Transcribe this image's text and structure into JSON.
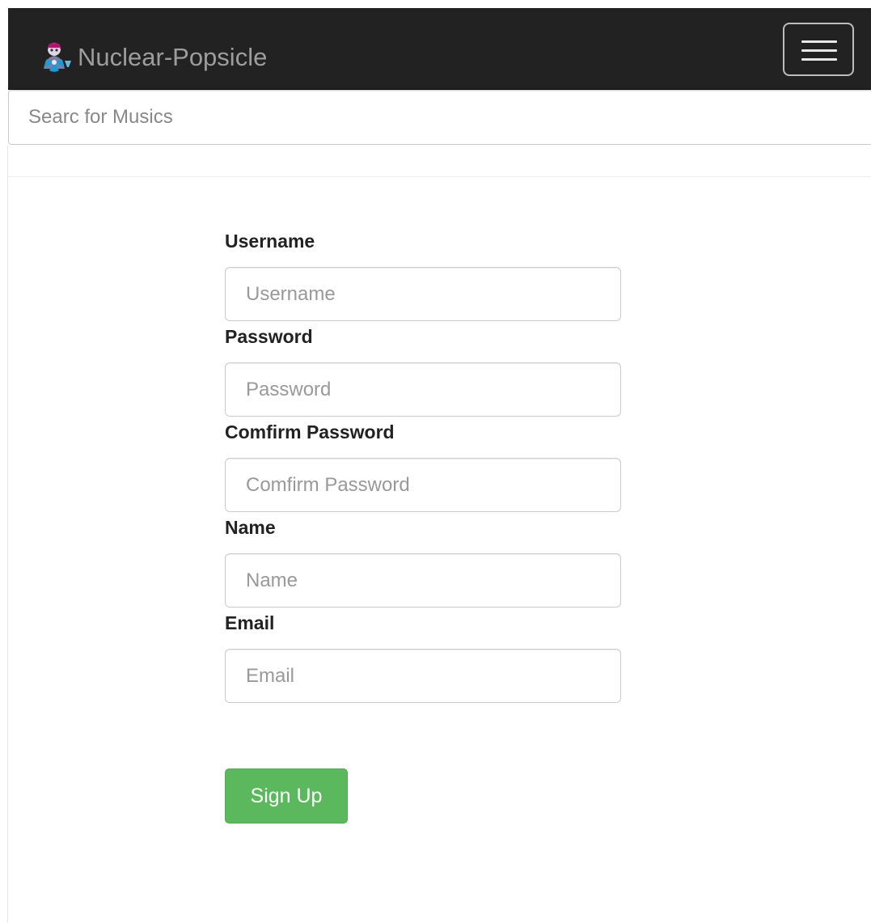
{
  "navbar": {
    "brand_name": "Nuclear-Popsicle",
    "logo_icon": "radiation-shield-logo-icon",
    "toggle_icon": "hamburger-menu-icon",
    "background_color": "#222222"
  },
  "search": {
    "placeholder": "Searc for Musics",
    "value": ""
  },
  "form": {
    "fields": [
      {
        "label": "Username",
        "placeholder": "Username",
        "value": ""
      },
      {
        "label": "Password",
        "placeholder": "Password",
        "value": ""
      },
      {
        "label": "Comfirm Password",
        "placeholder": "Comfirm Password",
        "value": ""
      },
      {
        "label": "Name",
        "placeholder": "Name",
        "value": ""
      },
      {
        "label": "Email",
        "placeholder": "Email",
        "value": ""
      }
    ],
    "submit_label": "Sign Up",
    "submit_color": "#5cb85c"
  }
}
